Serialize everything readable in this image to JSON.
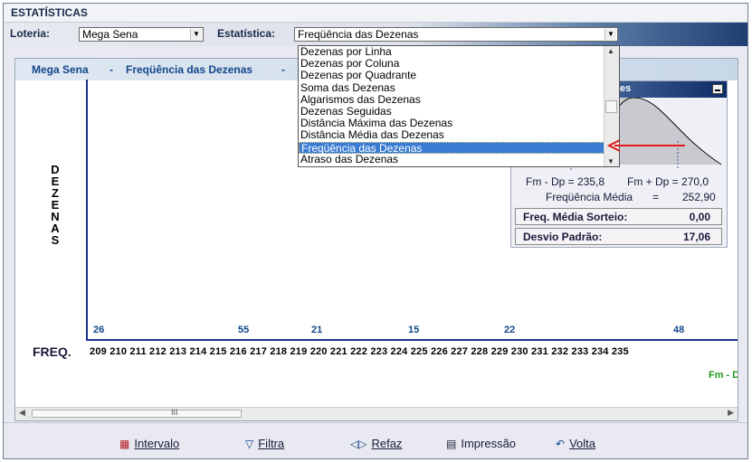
{
  "window": {
    "title": "ESTATÍSTICAS"
  },
  "toolbar": {
    "loteria_label": "Loteria:",
    "loteria_value": "Mega Sena",
    "estatistica_label": "Estatística:",
    "estatistica_value": "Freqüência das Dezenas"
  },
  "dropdown": {
    "items": [
      "Dezenas por Linha",
      "Dezenas por Coluna",
      "Dezenas por Quadrante",
      "Soma das Dezenas",
      "Algarismos das Dezenas",
      "Dezenas Seguidas",
      "Distância Máxima das Dezenas",
      "Distância Média das Dezenas",
      "Freqüência das Dezenas",
      "Atraso das Dezenas"
    ],
    "selected_index": 8
  },
  "chart": {
    "header_loteria": "Mega Sena",
    "header_sep1": "-",
    "header_stat": "Freqüência das Dezenas",
    "header_sep2": "-",
    "y_label": [
      "D",
      "E",
      "Z",
      "E",
      "N",
      "A",
      "S"
    ],
    "freq_label": "FREQ.",
    "freq_values": "209 210 211 212 213 214 215 216 217 218 219 220 221 222 223 224 225 226 227 228 229 230 231 232 233 234 235",
    "counts": [
      "26",
      "55",
      "21",
      "15",
      "22",
      "48"
    ],
    "fm_dp_label": "Fm - Dp",
    "scroll_grip": "III"
  },
  "gauss_panel": {
    "title_fragment": "es",
    "fm_minus_dp": "Fm - Dp = 235,8",
    "fm_plus_dp": "Fm + Dp = 270,0",
    "freq_media_label": "Freqüência Média",
    "freq_media_eq": "=",
    "freq_media_value": "252,90",
    "stats": [
      {
        "label": "Freq. Média Sorteio:",
        "value": "0,00"
      },
      {
        "label": "Desvio Padrão:",
        "value": "17,06"
      }
    ]
  },
  "buttons": {
    "intervalo": "Intervalo",
    "filtra": "Filtra",
    "refaz": "Refaz",
    "impressao": "Impressão",
    "volta": "Volta"
  },
  "colors": {
    "axis": "#1c2f8a",
    "selection": "#3a7bd4",
    "arrow": "#e01818",
    "count_text": "#12468a",
    "fm_dp_text": "#1e9a1e"
  }
}
